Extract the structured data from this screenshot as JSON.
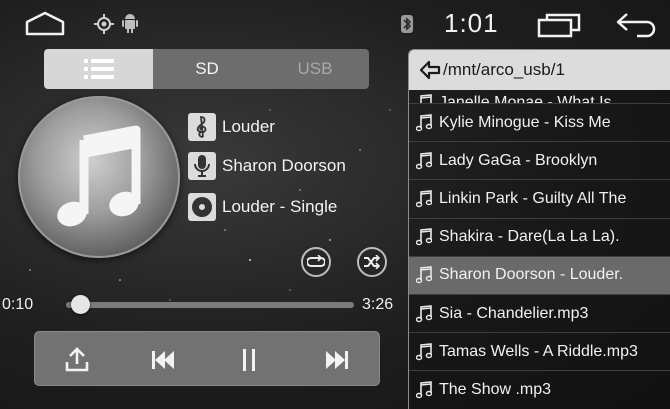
{
  "status_bar": {
    "time": "1:01",
    "icons": [
      "home-icon",
      "location-icon",
      "android-icon",
      "bluetooth-icon",
      "recent-apps-icon",
      "back-icon"
    ]
  },
  "source_tabs": [
    {
      "label": "",
      "icon": "list-icon",
      "active": true
    },
    {
      "label": "SD",
      "active": false
    },
    {
      "label": "USB",
      "active": false,
      "disabled": true
    }
  ],
  "track": {
    "title": "Louder",
    "artist": "Sharon Doorson",
    "album": "Louder - Single"
  },
  "progress": {
    "elapsed": "0:10",
    "total": "3:26",
    "fraction": 0.049
  },
  "controls": [
    "share-icon",
    "previous-icon",
    "pause-icon",
    "next-icon"
  ],
  "playlist": {
    "path": "/mnt/arco_usb/1",
    "items": [
      {
        "title": "Janelle Monae - What Is",
        "partial": true
      },
      {
        "title": "Kylie Minogue - Kiss Me"
      },
      {
        "title": "Lady GaGa - Brooklyn"
      },
      {
        "title": "Linkin Park - Guilty All The"
      },
      {
        "title": "Shakira - Dare(La La La)."
      },
      {
        "title": "Sharon Doorson - Louder.",
        "selected": true
      },
      {
        "title": "Sia - Chandelier.mp3"
      },
      {
        "title": "Tamas Wells - A Riddle.mp3"
      },
      {
        "title": "The Show .mp3"
      }
    ]
  },
  "colors": {
    "tab_active": "#d7d7d7",
    "tab_inactive": "#6d6d6d",
    "selected_row": "#6a6a6a",
    "header_bg": "#dcdcdc"
  }
}
